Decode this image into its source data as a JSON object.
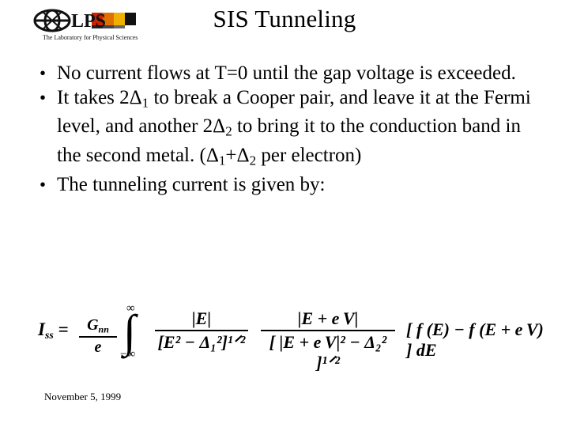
{
  "logo": {
    "name": "lps-logo",
    "main_text": "LPS",
    "tagline": "The Laboratory for Physical Sciences"
  },
  "slide": {
    "title": "SIS Tunneling",
    "footer_date": "November 5, 1999"
  },
  "bullets": [
    {
      "marker": "•",
      "parts": [
        {
          "t": "No current flows at T=0 until the gap voltage is exceeded."
        }
      ]
    },
    {
      "marker": "•",
      "parts": [
        {
          "t": "It takes 2Δ"
        },
        {
          "t": "1",
          "sub": true
        },
        {
          "t": "  to break a Cooper pair, and leave it at the Fermi level, and another 2Δ"
        },
        {
          "t": "2",
          "sub": true
        },
        {
          "t": " to bring it to the conduction band in the second metal. (Δ"
        },
        {
          "t": "1",
          "sub": true
        },
        {
          "t": "+Δ"
        },
        {
          "t": "2",
          "sub": true
        },
        {
          "t": " per electron)"
        }
      ]
    },
    {
      "marker": "•",
      "parts": [
        {
          "t": "The tunneling current is given by:"
        }
      ]
    }
  ],
  "equation": {
    "lhs_symbol": "I",
    "lhs_sub": "ss",
    "equals": "=",
    "frac1_num": "G",
    "frac1_num_sub": "nn",
    "frac1_den": "e",
    "integral": "∫",
    "integral_upper": "∞",
    "integral_lower": "−∞",
    "frac2_num": "|E|",
    "frac2_den": "[E² − Δ₁²]¹ᐟ²",
    "frac3_num": "|E + e V|",
    "frac3_den": "[ |E + e V|² − Δ₂² ]¹ᐟ²",
    "bracket_term": "[ f (E) − f (E + e V) ] dE"
  }
}
